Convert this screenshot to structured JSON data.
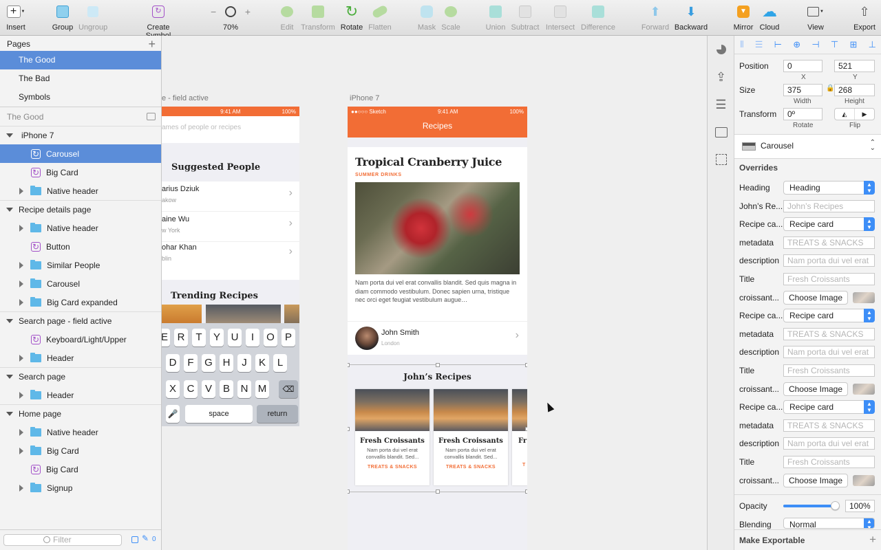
{
  "toolbar": {
    "insert": "Insert",
    "group": "Group",
    "ungroup": "Ungroup",
    "create_symbol": "Create Symbol",
    "zoom": "70%",
    "edit": "Edit",
    "transform": "Transform",
    "rotate": "Rotate",
    "flatten": "Flatten",
    "mask": "Mask",
    "scale": "Scale",
    "union": "Union",
    "subtract": "Subtract",
    "intersect": "Intersect",
    "difference": "Difference",
    "forward": "Forward",
    "backward": "Backward",
    "mirror": "Mirror",
    "cloud": "Cloud",
    "view": "View",
    "export": "Export",
    "zoom_minus": "−",
    "zoom_plus": "+"
  },
  "pages": {
    "header": "Pages",
    "add": "+",
    "items": [
      "The Good",
      "The Bad",
      "Symbols"
    ]
  },
  "layers": {
    "header": "The Good",
    "items": [
      {
        "label": "iPhone 7"
      },
      {
        "label": "Carousel"
      },
      {
        "label": "Big Card"
      },
      {
        "label": "Native header"
      },
      {
        "label": "Recipe details page"
      },
      {
        "label": "Native header"
      },
      {
        "label": "Button"
      },
      {
        "label": "Similar People"
      },
      {
        "label": "Carousel"
      },
      {
        "label": "Big Card expanded"
      },
      {
        "label": "Search page - field active"
      },
      {
        "label": "Keyboard/Light/Upper"
      },
      {
        "label": "Header"
      },
      {
        "label": "Search page"
      },
      {
        "label": "Header"
      },
      {
        "label": "Home page"
      },
      {
        "label": "Native header"
      },
      {
        "label": "Big Card"
      },
      {
        "label": "Big Card"
      },
      {
        "label": "Signup"
      }
    ],
    "filter_placeholder": "Filter",
    "filter_count": "0"
  },
  "canvas": {
    "artboard_search_label": "e - field active",
    "artboard_iphone_label": "iPhone 7",
    "search": {
      "time": "9:41 AM",
      "battery": "100%",
      "placeholder": "ames of people or recipes",
      "suggested": "Suggested People",
      "people": [
        {
          "name": "arius Dziuk",
          "city": "akow"
        },
        {
          "name": "aine Wu",
          "city": "w York"
        },
        {
          "name": "ohar Khan",
          "city": "blin"
        }
      ],
      "trending": "Trending Recipes",
      "kb_row1": [
        "E",
        "R",
        "T",
        "Y",
        "U",
        "I",
        "O",
        "P"
      ],
      "kb_row2": [
        "D",
        "F",
        "G",
        "H",
        "J",
        "K",
        "L"
      ],
      "kb_row3": [
        "X",
        "C",
        "V",
        "B",
        "N",
        "M"
      ],
      "space": "space",
      "return": "return"
    },
    "iphone": {
      "carrier": "●●○○○ Sketch",
      "time": "9:41 AM",
      "battery": "100%",
      "nav_title": "Recipes",
      "card_title": "Tropical Cranberry Juice",
      "card_category": "SUMMER DRINKS",
      "card_desc": "Nam porta dui vel erat convallis blandit. Sed quis magna in diam commodo vestibulum. Donec sapien urna, tristique nec orci eget feugiat vestibulum augue…",
      "author_name": "John Smith",
      "author_city": "London",
      "carousel_title": "John’s Recipes",
      "carousel_items": [
        {
          "title": "Fresh Croissants",
          "desc": "Nam porta dui vel erat convallis blandit. Sed...",
          "tag": "TREATS & SNACKS"
        },
        {
          "title": "Fresh Croissants",
          "desc": "Nam porta dui vel erat convallis blandit. Sed...",
          "tag": "TREATS & SNACKS"
        },
        {
          "title": "Fr",
          "desc": "",
          "tag": "T"
        }
      ]
    }
  },
  "inspector": {
    "position_label": "Position",
    "x": "0",
    "y": "521",
    "x_label": "X",
    "y_label": "Y",
    "size_label": "Size",
    "width": "375",
    "height": "268",
    "width_label": "Width",
    "height_label": "Height",
    "transform_label": "Transform",
    "rotate": "0º",
    "rotate_label": "Rotate",
    "flip_label": "Flip",
    "symbol_name": "Carousel",
    "overrides_label": "Overrides",
    "overrides": [
      {
        "label": "Heading",
        "type": "select",
        "value": "Heading"
      },
      {
        "label": "John’s Re...",
        "type": "text",
        "value": "John’s Recipes"
      },
      {
        "label": "Recipe ca...",
        "type": "select",
        "value": "Recipe card"
      },
      {
        "label": "metadata",
        "type": "text",
        "value": "TREATS & SNACKS"
      },
      {
        "label": "description",
        "type": "text",
        "value": "Nam porta dui vel erat"
      },
      {
        "label": "Title",
        "type": "text",
        "value": "Fresh Croissants"
      },
      {
        "label": "croissant...",
        "type": "image",
        "value": "Choose Image"
      },
      {
        "label": "Recipe ca...",
        "type": "select",
        "value": "Recipe card"
      },
      {
        "label": "metadata",
        "type": "text",
        "value": "TREATS & SNACKS"
      },
      {
        "label": "description",
        "type": "text",
        "value": "Nam porta dui vel erat"
      },
      {
        "label": "Title",
        "type": "text",
        "value": "Fresh Croissants"
      },
      {
        "label": "croissant...",
        "type": "image",
        "value": "Choose Image"
      },
      {
        "label": "Recipe ca...",
        "type": "select",
        "value": "Recipe card"
      },
      {
        "label": "metadata",
        "type": "text",
        "value": "TREATS & SNACKS"
      },
      {
        "label": "description",
        "type": "text",
        "value": "Nam porta dui vel erat"
      },
      {
        "label": "Title",
        "type": "text",
        "value": "Fresh Croissants"
      },
      {
        "label": "croissant...",
        "type": "image",
        "value": "Choose Image"
      }
    ],
    "opacity_label": "Opacity",
    "opacity": "100%",
    "opacity_level": 1.0,
    "blending_label": "Blending",
    "blending": "Normal",
    "make_exportable": "Make Exportable"
  },
  "colors": {
    "selection": "#5b8dd9",
    "brand_orange": "#f26d35",
    "symbol_purple": "#a24fc8",
    "folder_blue": "#5fb8e8"
  }
}
